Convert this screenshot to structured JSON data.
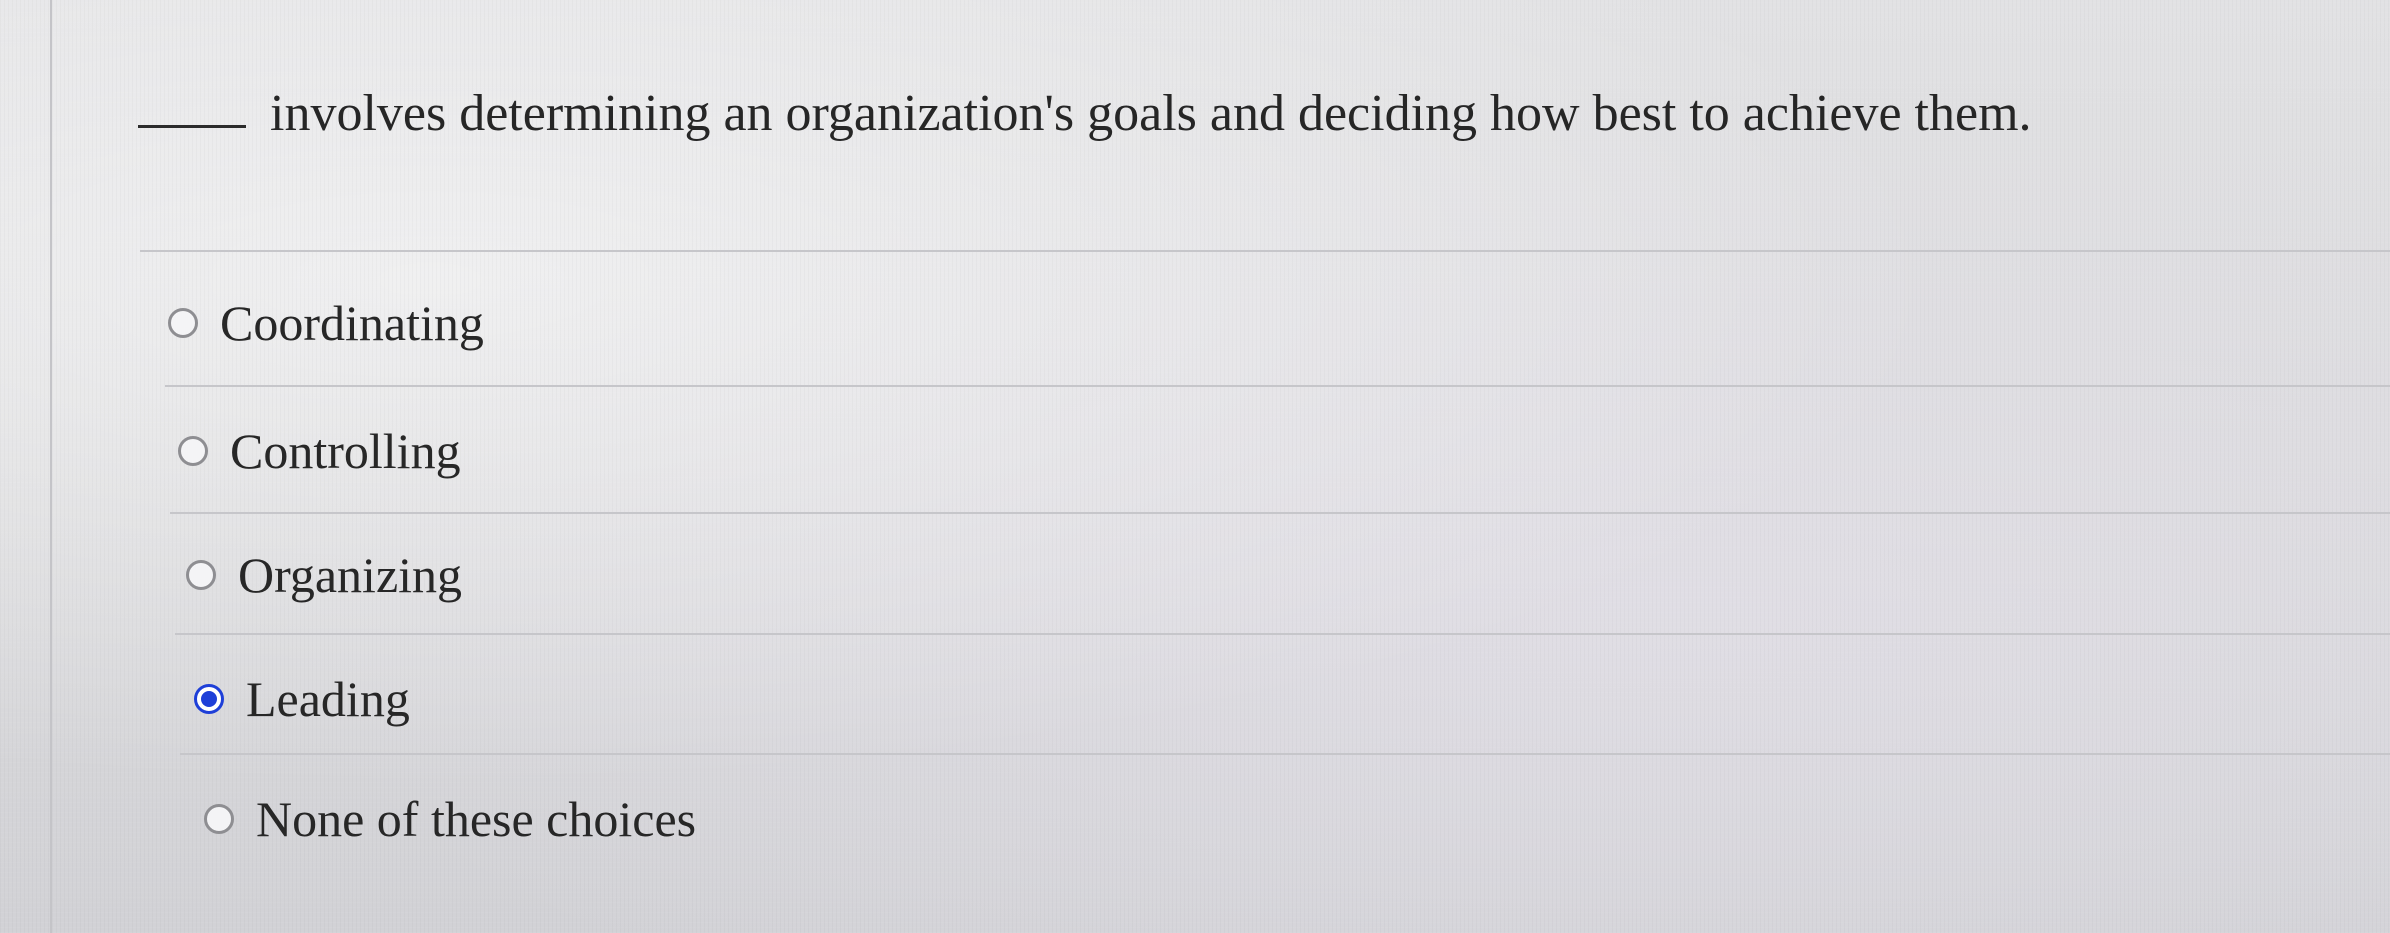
{
  "question": {
    "blank": "_____",
    "text": "involves determining an organization's goals and deciding how best to achieve them."
  },
  "options": [
    {
      "label": "Coordinating",
      "selected": false
    },
    {
      "label": "Controlling",
      "selected": false
    },
    {
      "label": "Organizing",
      "selected": false
    },
    {
      "label": "Leading",
      "selected": true
    },
    {
      "label": "None of these choices",
      "selected": false
    }
  ],
  "colors": {
    "selected_radio": "#1e3fd8",
    "text": "#272727",
    "background": "#dcdcde"
  }
}
